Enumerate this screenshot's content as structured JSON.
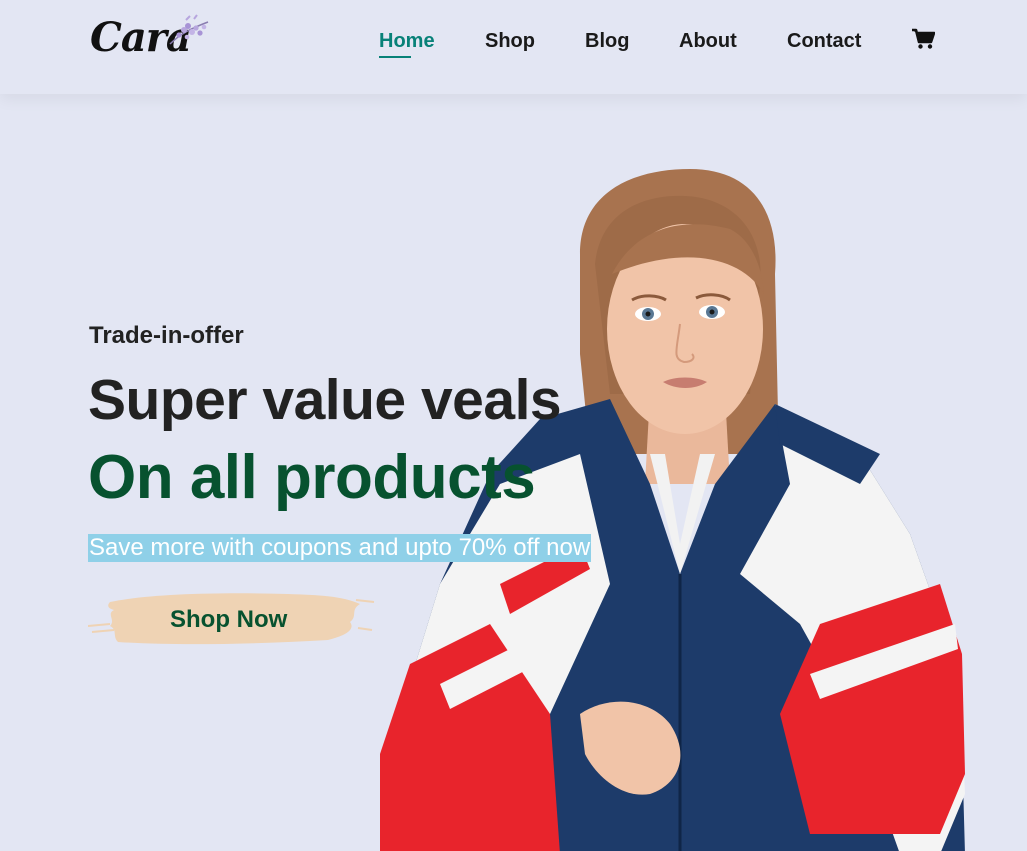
{
  "brand": {
    "name": "Cara"
  },
  "nav": {
    "items": [
      {
        "label": "Home",
        "active": true
      },
      {
        "label": "Shop",
        "active": false
      },
      {
        "label": "Blog",
        "active": false
      },
      {
        "label": "About",
        "active": false
      },
      {
        "label": "Contact",
        "active": false
      }
    ],
    "cart_icon": "shopping-cart-icon"
  },
  "hero": {
    "kicker": "Trade-in-offer",
    "headline": "Super value veals",
    "highlight": "On all products",
    "subtitle": "Save more with coupons and upto 70% off now",
    "cta_label": "Shop Now"
  },
  "colors": {
    "background": "#e3e6f3",
    "accent": "#088178",
    "headline_green": "#07522f",
    "selection": "#8fd0e8",
    "brush": "#efd3b4"
  }
}
